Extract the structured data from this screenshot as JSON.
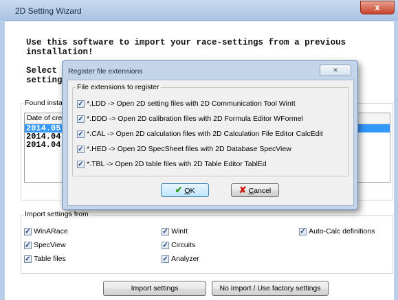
{
  "window": {
    "title": "2D Setting Wizard",
    "close_glyph": "x",
    "intro_line1": "Use this software to import your race-settings from a previous",
    "intro_line2": "installation!",
    "select_line1_visible": "Select t",
    "select_line2_visible": "settings"
  },
  "found_group": {
    "label_visible": "Found instal",
    "column_header_visible": "Date of cre",
    "rows": [
      "2014.05",
      "2014.04",
      "2014.04"
    ]
  },
  "import_group": {
    "label": "Import settings from",
    "checkboxes": [
      {
        "label": "WinARace",
        "checked": true
      },
      {
        "label": "WinIt",
        "checked": true
      },
      {
        "label": "Auto-Calc definitions",
        "checked": true
      },
      {
        "label": "SpecView",
        "checked": true
      },
      {
        "label": "Circuits",
        "checked": true
      },
      {
        "label": "Table files",
        "checked": true
      },
      {
        "label": "Analyzer",
        "checked": true
      }
    ]
  },
  "buttons": {
    "import": "Import settings",
    "no_import": "No Import / Use factory settings"
  },
  "dialog": {
    "title": "Register file extensions",
    "close_glyph": "✕",
    "group_label": "File extensions to register",
    "extensions": [
      {
        "label": "*.LDD  -> Open 2D setting files with 2D Communication Tool WinIt",
        "checked": true
      },
      {
        "label": "*.DDD  -> Open 2D calibration files with 2D Formula Editor WFormel",
        "checked": true
      },
      {
        "label": "*.CAL  -> Open 2D calculation files with 2D Calculation File Editor CalcEdit",
        "checked": true
      },
      {
        "label": "*.HED  -> Open 2D SpecSheet files with 2D Database SpecView",
        "checked": true
      },
      {
        "label": "*.TBL  -> Open 2D table files with 2D Table Editor TablEd",
        "checked": true
      }
    ],
    "ok_accel": "O",
    "ok_rest": "K",
    "cancel_accel": "C",
    "cancel_rest": "ancel"
  },
  "icons": {
    "check": "✓",
    "checkmark_glyph": "✔",
    "cancel_glyph": "✘"
  }
}
